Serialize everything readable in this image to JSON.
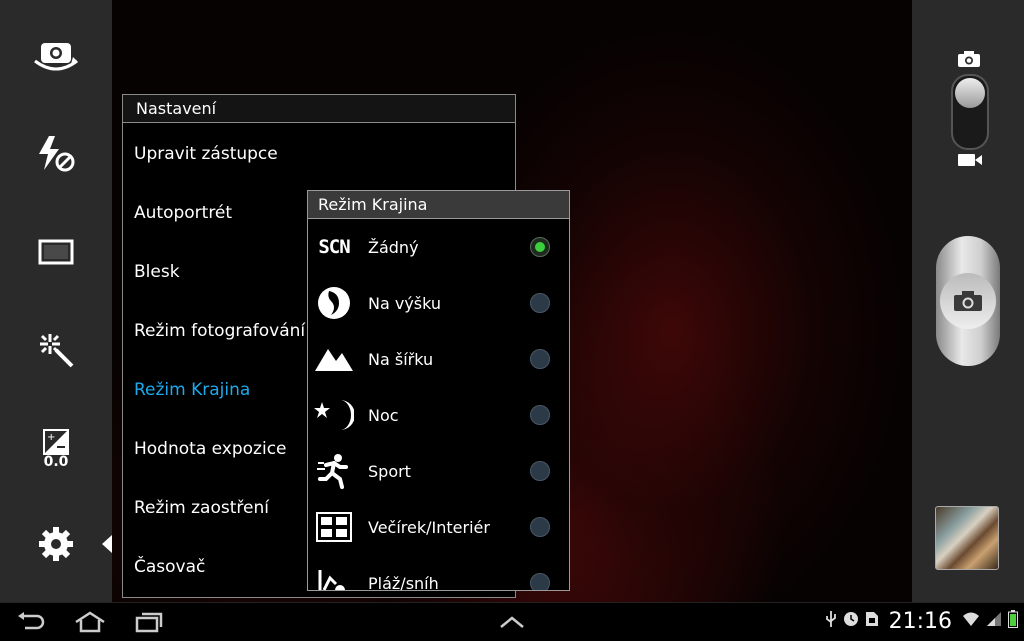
{
  "settings": {
    "title": "Nastavení",
    "items": [
      {
        "label": "Upravit zástupce"
      },
      {
        "label": "Autoportrét"
      },
      {
        "label": "Blesk"
      },
      {
        "label": "Režim fotografování"
      },
      {
        "label": "Režim Krajina",
        "active": true
      },
      {
        "label": "Hodnota expozice"
      },
      {
        "label": "Režim zaostření"
      },
      {
        "label": "Časovač"
      }
    ]
  },
  "scene_popup": {
    "title": "Režim Krajina",
    "options": [
      {
        "label": "Žádný",
        "icon": "scn-icon",
        "selected": true
      },
      {
        "label": "Na výšku",
        "icon": "portrait-icon",
        "selected": false
      },
      {
        "label": "Na šířku",
        "icon": "landscape-icon",
        "selected": false
      },
      {
        "label": "Noc",
        "icon": "night-icon",
        "selected": false
      },
      {
        "label": "Sport",
        "icon": "sport-icon",
        "selected": false
      },
      {
        "label": "Večírek/Interiér",
        "icon": "party-icon",
        "selected": false
      },
      {
        "label": "Pláž/sníh",
        "icon": "beach-snow-icon",
        "selected": false
      }
    ]
  },
  "left_toolbar": {
    "exposure_value": "0.0",
    "icons": [
      "switch-camera-icon",
      "flash-off-icon",
      "aspect-ratio-icon",
      "effects-icon",
      "exposure-icon",
      "settings-gear-icon"
    ]
  },
  "status_bar": {
    "time": "21:16"
  },
  "colors": {
    "accent": "#1ea9ec",
    "radio_selected": "#3ccf3c",
    "bar_background": "#2a2a2a"
  }
}
